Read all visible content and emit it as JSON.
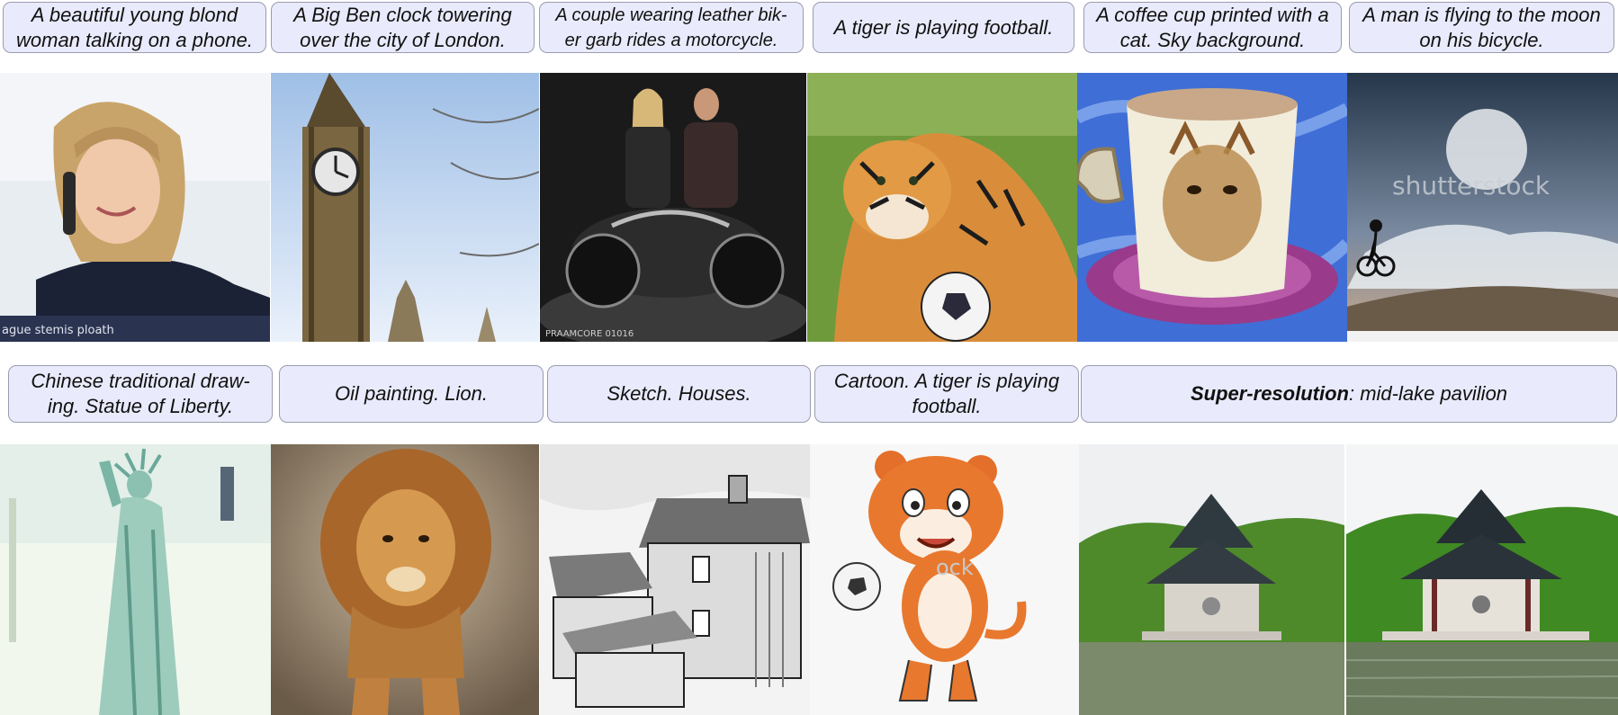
{
  "row1": {
    "captions": [
      "A beautiful young blond woman talking on a phone.",
      "A Big Ben clock towering over the city of London.",
      "A couple wearing leather bik- er garb rides a motorcycle.",
      "A tiger is playing football.",
      "A coffee cup printed with a cat. Sky background.",
      "A man is flying to the moon on his bicycle."
    ],
    "image_texts": {
      "woman_watermark": "ague stemis ploath",
      "motorcycle_watermark": "PRAAMCORE 01016",
      "moon_watermark": "shutterstock"
    }
  },
  "row2": {
    "captions": [
      "Chinese traditional draw- ing. Statue of Liberty.",
      "Oil painting. Lion.",
      "Sketch. Houses.",
      "Cartoon. A tiger is playing football."
    ],
    "sr_caption_bold": "Super-resolution",
    "sr_caption_rest": ": mid-lake pavilion",
    "image_texts": {
      "tiger_cartoon_watermark": "ock"
    }
  },
  "colors": {
    "caption_bg": "#e9eafb",
    "caption_border": "#9a9cb0"
  }
}
